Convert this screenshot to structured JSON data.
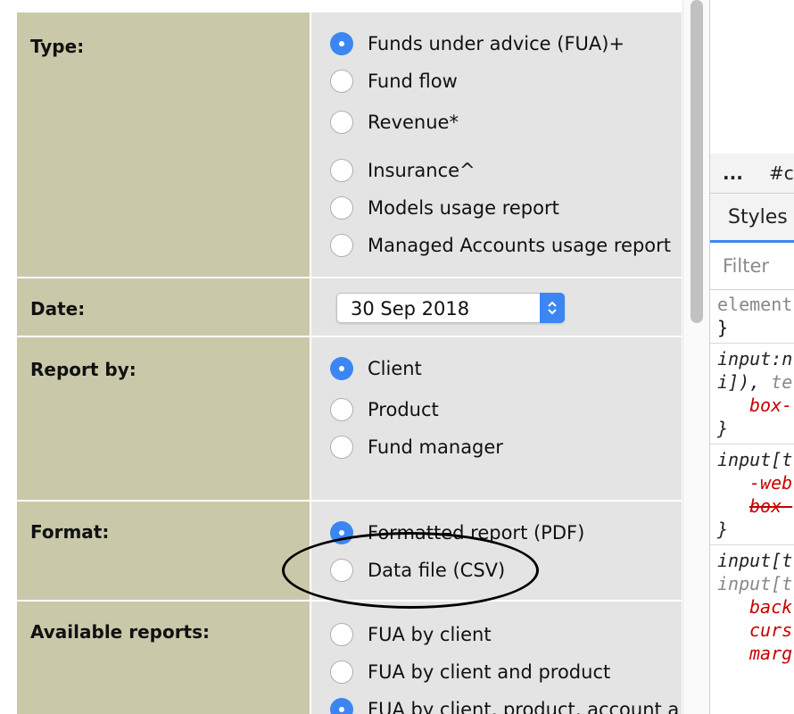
{
  "form": {
    "type": {
      "label": "Type:",
      "options": [
        {
          "label": "Funds under advice (FUA)+",
          "checked": true
        },
        {
          "label": "Fund flow",
          "checked": false
        },
        {
          "label": "Revenue*",
          "checked": false
        },
        {
          "label": "Insurance^",
          "checked": false
        },
        {
          "label": "Models usage report",
          "checked": false
        },
        {
          "label": "Managed Accounts usage report",
          "checked": false
        }
      ]
    },
    "date": {
      "label": "Date:",
      "value": "30 Sep 2018"
    },
    "report_by": {
      "label": "Report by:",
      "options": [
        {
          "label": "Client",
          "checked": true
        },
        {
          "label": "Product",
          "checked": false
        },
        {
          "label": "Fund manager",
          "checked": false
        }
      ]
    },
    "format": {
      "label": "Format:",
      "options": [
        {
          "label": "Formatted report (PDF)",
          "checked": true
        },
        {
          "label": "Data file (CSV)",
          "checked": false
        }
      ]
    },
    "available_reports": {
      "label": "Available reports:",
      "options": [
        {
          "label": "FUA by client",
          "checked": false
        },
        {
          "label": "FUA by client and product",
          "checked": false
        },
        {
          "label": "FUA by client, product, account a",
          "checked": true
        }
      ]
    }
  },
  "devtools": {
    "breadcrumb_dots": "...",
    "breadcrumb_selector": "#c",
    "tab_styles": "Styles",
    "filter_placeholder": "Filter",
    "rules": {
      "r1_selector": "element",
      "r1_close": "}",
      "r2_selector_a": "input:n",
      "r2_selector_b": "i]),",
      "r2_selector_c": "te",
      "r2_prop": "box-",
      "r2_close": "}",
      "r3_selector": "input[t",
      "r3_prop1": "-web",
      "r3_prop2": "box-",
      "r3_close": "}",
      "r4_selector": "input[t",
      "r4_selector_b": "input[t",
      "r4_prop1": "back",
      "r4_prop2": "curs",
      "r4_prop3": "marg"
    }
  },
  "colors": {
    "label_cell": "#c9c9aa",
    "value_cell": "#e4e4e4",
    "radio_checked": "#3b86f2"
  }
}
